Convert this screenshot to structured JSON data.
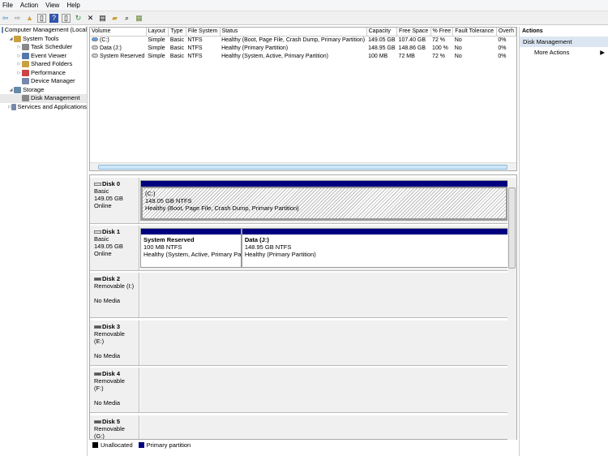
{
  "menu": [
    "File",
    "Action",
    "View",
    "Help"
  ],
  "tree": [
    {
      "label": "Computer Management (Local",
      "indent": 0,
      "expander": "",
      "color": "#6688aa"
    },
    {
      "label": "System Tools",
      "indent": 1,
      "expander": "◢",
      "color": "#c8a040"
    },
    {
      "label": "Task Scheduler",
      "indent": 2,
      "expander": "▷",
      "color": "#888"
    },
    {
      "label": "Event Viewer",
      "indent": 2,
      "expander": "▷",
      "color": "#5577aa"
    },
    {
      "label": "Shared Folders",
      "indent": 2,
      "expander": "▷",
      "color": "#c8a040"
    },
    {
      "label": "Performance",
      "indent": 2,
      "expander": "▷",
      "color": "#cc4444"
    },
    {
      "label": "Device Manager",
      "indent": 2,
      "expander": "",
      "color": "#7788aa"
    },
    {
      "label": "Storage",
      "indent": 1,
      "expander": "◢",
      "color": "#6688aa"
    },
    {
      "label": "Disk Management",
      "indent": 2,
      "expander": "",
      "color": "#888",
      "selected": true
    },
    {
      "label": "Services and Applications",
      "indent": 1,
      "expander": "▷",
      "color": "#7788aa"
    }
  ],
  "list": {
    "columns": [
      "Volume",
      "Layout",
      "Type",
      "File System",
      "Status",
      "Capacity",
      "Free Space",
      "% Free",
      "Fault Tolerance",
      "Overh"
    ],
    "rows": [
      [
        "(C:)",
        "Simple",
        "Basic",
        "NTFS",
        "Healthy (Boot, Page File, Crash Dump, Primary Partition)",
        "149.05 GB",
        "107.40 GB",
        "72 %",
        "No",
        "0%"
      ],
      [
        "Data (J:)",
        "Simple",
        "Basic",
        "NTFS",
        "Healthy (Primary Partition)",
        "148.95 GB",
        "148.86 GB",
        "100 %",
        "No",
        "0%"
      ],
      [
        "System Reserved",
        "Simple",
        "Basic",
        "NTFS",
        "Healthy (System, Active, Primary Partition)",
        "100 MB",
        "72 MB",
        "72 %",
        "No",
        "0%"
      ]
    ]
  },
  "disks": [
    {
      "name": "Disk 0",
      "type": "Basic",
      "size": "149.05 GB",
      "state": "Online",
      "partitions": [
        {
          "name": "(C:)",
          "size": "149.05 GB NTFS",
          "status": "Healthy (Boot, Page File, Crash Dump, Primary Partition)",
          "selected": true
        }
      ]
    },
    {
      "name": "Disk 1",
      "type": "Basic",
      "size": "149.05 GB",
      "state": "Online",
      "partitions": [
        {
          "name": "System Reserved",
          "size": "100 MB NTFS",
          "status": "Healthy (System, Active, Primary Part"
        },
        {
          "name": "Data  (J:)",
          "size": "148.95 GB NTFS",
          "status": "Healthy (Primary Partition)"
        }
      ]
    },
    {
      "name": "Disk 2",
      "type": "Removable (I:)",
      "size": "",
      "state": "No Media",
      "partitions": []
    },
    {
      "name": "Disk 3",
      "type": "Removable (E:)",
      "size": "",
      "state": "No Media",
      "partitions": []
    },
    {
      "name": "Disk 4",
      "type": "Removable (F:)",
      "size": "",
      "state": "No Media",
      "partitions": []
    },
    {
      "name": "Disk 5",
      "type": "Removable (G:)",
      "size": "",
      "state": "",
      "partitions": []
    }
  ],
  "legend": [
    {
      "label": "Unallocated",
      "color": "#000000"
    },
    {
      "label": "Primary partition",
      "color": "#00007f"
    }
  ],
  "actions": {
    "title": "Actions",
    "section": "Disk Management",
    "item": "More Actions"
  }
}
